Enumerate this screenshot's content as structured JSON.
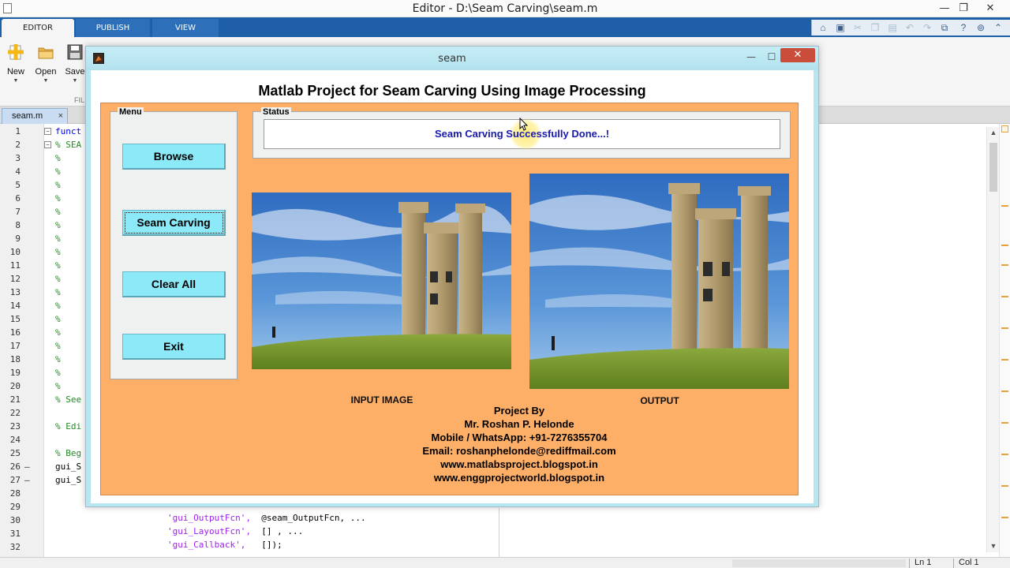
{
  "window": {
    "title": "Editor - D:\\Seam Carving\\seam.m",
    "controls": {
      "minimize": "—",
      "restore": "❐",
      "close": "✕"
    }
  },
  "ribbon": {
    "tabs": [
      {
        "label": "EDITOR",
        "active": true
      },
      {
        "label": "PUBLISH",
        "active": false
      },
      {
        "label": "VIEW",
        "active": false
      }
    ],
    "quick_access_icons": [
      "home-icon",
      "save-icon",
      "cut-icon",
      "copy-icon",
      "paste-icon",
      "undo-icon",
      "redo-icon",
      "switch-windows-icon",
      "help-icon",
      "search-icon",
      "collapse-icon"
    ]
  },
  "toolstrip": {
    "buttons": [
      {
        "label": "New",
        "icon": "new-file-icon"
      },
      {
        "label": "Open",
        "icon": "open-folder-icon"
      },
      {
        "label": "Save",
        "icon": "save-icon"
      }
    ],
    "section_label": "FIL"
  },
  "document_tab": {
    "label": "seam.m",
    "close": "×"
  },
  "editor": {
    "line_numbers": [
      "1",
      "2",
      "3",
      "4",
      "5",
      "6",
      "7",
      "8",
      "9",
      "10",
      "11",
      "12",
      "13",
      "14",
      "15",
      "16",
      "17",
      "18",
      "19",
      "20",
      "21",
      "22",
      "23",
      "24",
      "25",
      "26",
      "27",
      "28",
      "29",
      "30",
      "31",
      "32"
    ],
    "visible_left_code": [
      {
        "line": 1,
        "text": "funct",
        "style": "kw"
      },
      {
        "line": 2,
        "text": "% SEA",
        "style": "cmt"
      },
      {
        "line": 3,
        "text": "%",
        "style": "cmt"
      },
      {
        "line": 4,
        "text": "%",
        "style": "cmt"
      },
      {
        "line": 5,
        "text": "%",
        "style": "cmt"
      },
      {
        "line": 6,
        "text": "%",
        "style": "cmt"
      },
      {
        "line": 7,
        "text": "%",
        "style": "cmt"
      },
      {
        "line": 8,
        "text": "%",
        "style": "cmt"
      },
      {
        "line": 9,
        "text": "%",
        "style": "cmt"
      },
      {
        "line": 10,
        "text": "%",
        "style": "cmt"
      },
      {
        "line": 11,
        "text": "%",
        "style": "cmt"
      },
      {
        "line": 12,
        "text": "%",
        "style": "cmt"
      },
      {
        "line": 13,
        "text": "%",
        "style": "cmt"
      },
      {
        "line": 14,
        "text": "%",
        "style": "cmt"
      },
      {
        "line": 15,
        "text": "%",
        "style": "cmt"
      },
      {
        "line": 16,
        "text": "%",
        "style": "cmt"
      },
      {
        "line": 17,
        "text": "%",
        "style": "cmt"
      },
      {
        "line": 18,
        "text": "%",
        "style": "cmt"
      },
      {
        "line": 19,
        "text": "%",
        "style": "cmt"
      },
      {
        "line": 20,
        "text": "%",
        "style": "cmt"
      },
      {
        "line": 21,
        "text": "% See",
        "style": "cmt"
      },
      {
        "line": 23,
        "text": "% Edi",
        "style": "cmt"
      },
      {
        "line": 25,
        "text": "% Beg",
        "style": "cmt"
      },
      {
        "line": 26,
        "text": "gui_S",
        "style": ""
      },
      {
        "line": 27,
        "text": "gui_S",
        "style": ""
      }
    ],
    "code_line_30": {
      "str": "'gui_OutputFcn',",
      "rest": "  @seam_OutputFcn, ..."
    },
    "code_line_31": {
      "str": "'gui_LayoutFcn',",
      "rest": "  [] , ..."
    },
    "code_line_32": {
      "str": "'gui_Callback',",
      "rest": "   []);"
    }
  },
  "statusbar": {
    "ln": "Ln  1",
    "col": "Col  1"
  },
  "figure": {
    "title": "seam",
    "controls": {
      "minimize": "—",
      "maximize": "☐",
      "close": "✕"
    },
    "heading": "Matlab Project for Seam Carving Using Image Processing",
    "menu": {
      "legend": "Menu",
      "buttons": [
        "Browse",
        "Seam Carving",
        "Clear All",
        "Exit"
      ]
    },
    "status": {
      "legend": "Status",
      "message": "Seam Carving Successfully Done...!"
    },
    "input_caption": "INPUT IMAGE",
    "output_caption": "OUTPUT",
    "credits": [
      "Project By",
      "Mr. Roshan P. Helonde",
      "Mobile / WhatsApp: +91-7276355704",
      "Email: roshanphelonde@rediffmail.com",
      "www.matlabsproject.blogspot.in",
      "www.enggprojectworld.blogspot.in"
    ]
  },
  "colors": {
    "ribbon_blue": "#1e5fa8",
    "figure_background": "#fdae67",
    "button_cyan": "#8ceaf8",
    "status_text": "#1a1ab0"
  }
}
